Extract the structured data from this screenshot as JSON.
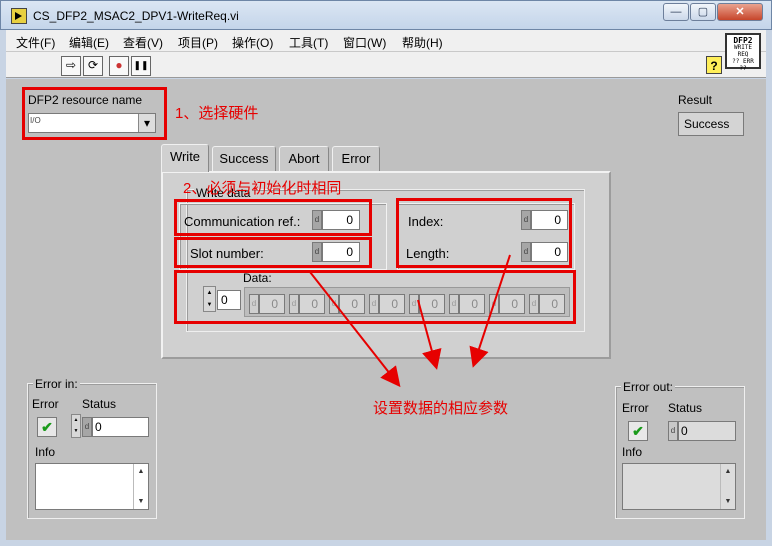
{
  "window": {
    "title": "CS_DFP2_MSAC2_DPV1-WriteReq.vi",
    "minimize": "—",
    "maximize": "▢",
    "close": "✕"
  },
  "menu": [
    {
      "label": "文件(F)"
    },
    {
      "label": "编辑(E)"
    },
    {
      "label": "查看(V)"
    },
    {
      "label": "项目(P)"
    },
    {
      "label": "操作(O)"
    },
    {
      "label": "工具(T)"
    },
    {
      "label": "窗口(W)"
    },
    {
      "label": "帮助(H)"
    }
  ],
  "toolbar": {
    "run": "⇨",
    "run_continuous": "⟳",
    "abort": "●",
    "pause": "❚❚",
    "help": "?"
  },
  "vi_icon": {
    "line1": "DFP2",
    "line2": "WRITE",
    "line3": "REQ",
    "line4": "?? ERR ??"
  },
  "resource": {
    "label": "DFP2 resource name",
    "prefix": "I/O",
    "value": "",
    "dropdown": "▾"
  },
  "annotations": {
    "a1": "1、选择硬件",
    "a2": "2、必须与初始化时相同",
    "a3": "设置数据的相应参数"
  },
  "result": {
    "label": "Result",
    "value": "Success"
  },
  "tabs": [
    {
      "label": "Write"
    },
    {
      "label": "Success"
    },
    {
      "label": "Abort"
    },
    {
      "label": "Error"
    }
  ],
  "write_data": {
    "title": "Write data",
    "comm_ref": {
      "label": "Communication ref.:",
      "value": "0"
    },
    "slot": {
      "label": "Slot number:",
      "value": "0"
    },
    "index": {
      "label": "Index:",
      "value": "0"
    },
    "length": {
      "label": "Length:",
      "value": "0"
    },
    "data": {
      "label": "Data:",
      "array_index": "0",
      "values": [
        "0",
        "0",
        "0",
        "0",
        "0",
        "0",
        "0",
        "0"
      ]
    }
  },
  "radix": "d",
  "error_in": {
    "title": "Error in:",
    "error_label": "Error",
    "status_label": "Status",
    "status_value": "0",
    "info_label": "Info",
    "check": "✔"
  },
  "error_out": {
    "title": "Error out:",
    "error_label": "Error",
    "status_label": "Status",
    "status_value": "0",
    "info_label": "Info",
    "check": "✔"
  },
  "scroll": {
    "up": "▲",
    "down": "▼"
  }
}
